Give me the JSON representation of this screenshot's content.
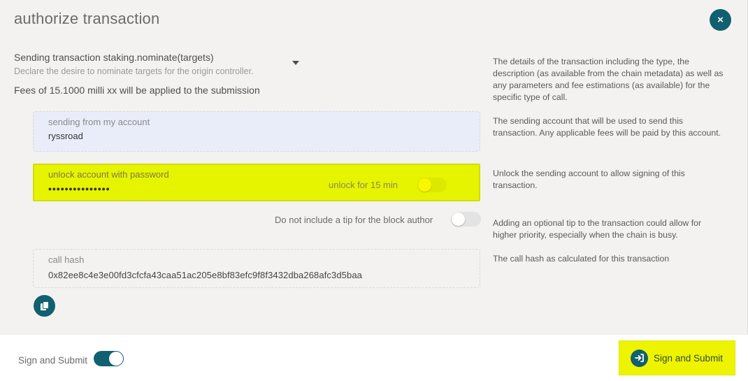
{
  "modal": {
    "title": "authorize transaction",
    "close_icon": "×"
  },
  "transaction": {
    "title": "Sending transaction staking.nominate(targets)",
    "description": "Declare the desire to nominate targets for the origin controller.",
    "fees": "Fees of 15.1000 milli xx will be applied to the submission"
  },
  "help": {
    "details": "The details of the transaction including the type, the description (as available from the chain metadata) as well as any parameters and fee estimations (as available) for the specific type of call.",
    "account": "The sending account that will be used to send this transaction. Any applicable fees will be paid by this account.",
    "unlock": "Unlock the sending account to allow signing of this transaction.",
    "tip": "Adding an optional tip to the transaction could allow for higher priority, especially when the chain is busy.",
    "hash": "The call hash as calculated for this transaction"
  },
  "account": {
    "label": "sending from my account",
    "value": "ryssroad"
  },
  "password": {
    "label": "unlock account with password",
    "value": "•••••••••••••••",
    "unlock_label": "unlock for 15 min",
    "unlock_toggle_on": false
  },
  "tip": {
    "label": "Do not include a tip for the block author",
    "toggle_on": false
  },
  "call_hash": {
    "label": "call hash",
    "value": "0x82ee8c4e3e00fd3cfcfa43caa51ac205e8bf83efc9f8f3432dba268afc3d5baa"
  },
  "footer": {
    "toggle_label": "Sign and Submit",
    "toggle_on": true,
    "submit_label": "Sign and Submit"
  },
  "colors": {
    "accent": "#11606f",
    "highlight": "#e6f400",
    "account_bg": "#e8edf9"
  }
}
